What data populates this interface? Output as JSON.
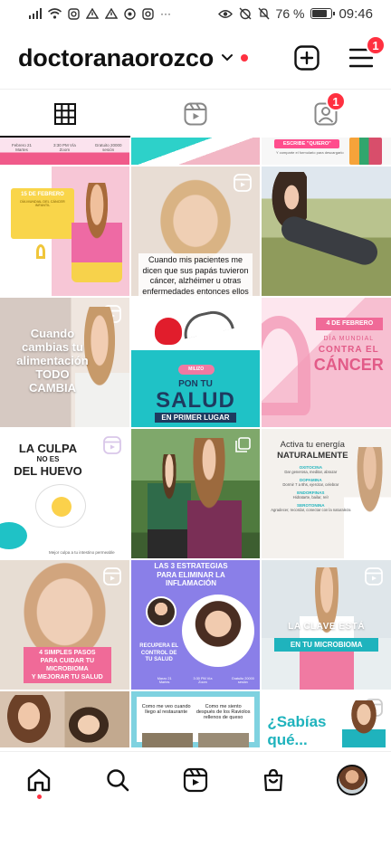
{
  "status_bar": {
    "battery_percent": "76 %",
    "time": "09:46",
    "battery_level": 0.76,
    "left_icons": [
      "signal-icon",
      "wifi-icon",
      "instagram-icon",
      "warning-icon",
      "warning-icon",
      "chrome-icon",
      "instagram-icon",
      "more-dots-icon"
    ],
    "right_icons": [
      "eye-icon",
      "alarm-off-icon",
      "mute-icon"
    ]
  },
  "header": {
    "username": "doctoranaorozco",
    "menu_badge": "1"
  },
  "tabs": {
    "tagged_badge": "1"
  },
  "posts": {
    "r0c0": {
      "date": "Febrero 21 Martes",
      "time": "3:30 PM Vía Zoom",
      "price": "Gratuito 20000 sesión"
    },
    "r0c2": {
      "button": "ESCRIBE \"QUIERO\"",
      "sub": "Y comparte el formulario para descargarlo"
    },
    "r1c0": {
      "title": "15 DE FEBRERO",
      "subtitle": "DÍA MUNDIAL DEL CÁNCER INFANTIL"
    },
    "r1c1": {
      "caption": "Cuando mis pacientes me dicen que sus papás tuvieron cáncer, alzhéimer u otras enfermedades entonces ellos"
    },
    "r2c0": {
      "line1": "Cuando",
      "line2": "cambias tu",
      "line3": "alimentación",
      "line4": "TODO",
      "line5": "CAMBIA"
    },
    "r2c1": {
      "pill": "MILIZO",
      "title_small": "PON TU",
      "title_big": "SALUD",
      "title_bottom": "EN PRIMER LUGAR"
    },
    "r2c2": {
      "date": "4 DE FEBRERO",
      "line1": "DÍA MUNDIAL",
      "line2": "CONTRA EL",
      "line3": "CÁNCER"
    },
    "r3c0": {
      "line1": "LA CULPA",
      "line2": "NO ES",
      "line3": "DEL HUEVO",
      "footer": "Mejor culpa a tu intestino permeable"
    },
    "r3c2": {
      "title1": "Activa tu energía",
      "title2": "NATURALMENTE",
      "items": [
        {
          "name": "OXITOCINA",
          "desc": "Dar generosa, meditar, abrazar"
        },
        {
          "name": "DOPAMINA",
          "desc": "Dormir 7 a 8hs, ejercitar, celebrar"
        },
        {
          "name": "ENDORFINAS",
          "desc": "Hidratarte, bailar, reír"
        },
        {
          "name": "SEROTONINA",
          "desc": "Agradecer, recordar, conectar con la naturaleza"
        }
      ]
    },
    "r4c0": {
      "line1": "4 SIMPLES PASOS",
      "line2": "PARA CUIDAR TU",
      "line3": "MICROBIOMA",
      "line4": "Y MEJORAR TU SALUD"
    },
    "r4c1": {
      "title1": "LAS 3 ESTRATEGIAS",
      "title2": "PARA ELIMINAR LA",
      "title3": "INFLAMACIÓN",
      "side1": "RECUPERA EL",
      "side2": "CONTROL DE",
      "side3": "TU SALUD",
      "date": "Marzo 21 Martes",
      "time": "3:30 PM Vía Zoom",
      "price": "Gratuito 20000 sesión"
    },
    "r4c2": {
      "line1": "LA CLAVE ESTÁ",
      "line2": "EN TU MICROBIOMA"
    },
    "r5c1": {
      "left": "Como me veo cuando llego al restaurante",
      "right": "Como me siento después de los Raviolos rellenos de queso"
    },
    "r5c2": {
      "line1": "¿Sabías",
      "line2": "qué..."
    }
  },
  "colors": {
    "accent_red": "#ff3040",
    "teal": "#18c4c9",
    "pink": "#f08aa8",
    "purple": "#7b6fe0",
    "yellow": "#f9d54a",
    "salud_blue": "#1e3a5f"
  }
}
